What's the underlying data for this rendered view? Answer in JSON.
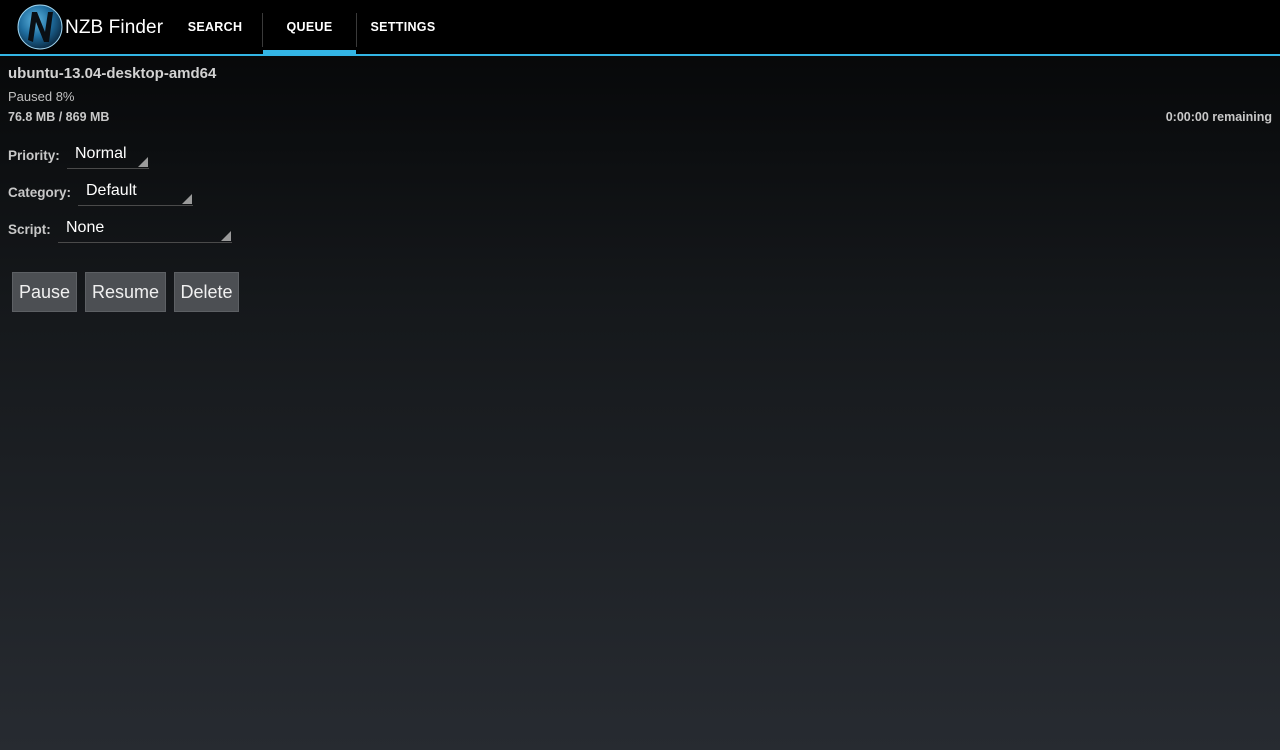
{
  "app": {
    "title": "NZB Finder",
    "logo_icon": "nzb-logo-icon",
    "accent": "#33b5e5"
  },
  "tabs": [
    {
      "label": "SEARCH",
      "selected": false
    },
    {
      "label": "QUEUE",
      "selected": true
    },
    {
      "label": "SETTINGS",
      "selected": false
    }
  ],
  "job": {
    "name": "ubuntu-13.04-desktop-amd64",
    "status": "Paused 8%",
    "size": "76.8 MB / 869 MB",
    "remaining": "0:00:00 remaining"
  },
  "fields": {
    "priority": {
      "label": "Priority:",
      "value": "Normal"
    },
    "category": {
      "label": "Category:",
      "value": "Default"
    },
    "script": {
      "label": "Script:",
      "value": "None"
    }
  },
  "buttons": {
    "pause": "Pause",
    "resume": "Resume",
    "delete": "Delete"
  }
}
